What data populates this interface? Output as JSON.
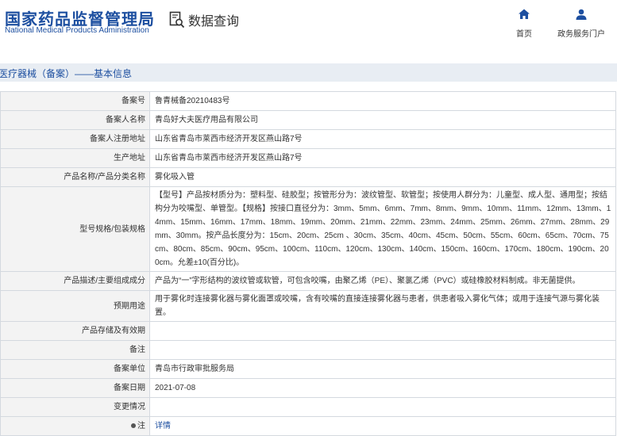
{
  "header": {
    "logo_cn": "国家药品监督管理局",
    "logo_en": "National Medical Products Administration",
    "query_label": "数据查询",
    "nav": [
      {
        "label": "首页",
        "icon": "home-icon"
      },
      {
        "label": "政务服务门户",
        "icon": "user-icon"
      }
    ]
  },
  "section": {
    "title": "医疗器械（备案）——基本信息"
  },
  "rows": [
    {
      "label": "备案号",
      "value": "鲁青械备20210483号"
    },
    {
      "label": "备案人名称",
      "value": "青岛好大夫医疗用品有限公司"
    },
    {
      "label": "备案人注册地址",
      "value": "山东省青岛市莱西市经济开发区燕山路7号"
    },
    {
      "label": "生产地址",
      "value": "山东省青岛市莱西市经济开发区燕山路7号"
    },
    {
      "label": "产品名称/产品分类名称",
      "value": "雾化吸入管"
    },
    {
      "label": "型号规格/包装规格",
      "value": "【型号】产品按材质分为：塑料型、硅胶型；按管形分为：波纹管型、软管型；按使用人群分为：儿童型、成人型、通用型；按结构分为咬嘴型、单管型。【规格】按接口直径分为：3mm、5mm、6mm、7mm、8mm、9mm、10mm、11mm、12mm、13mm、14mm、15mm、16mm、17mm、18mm、19mm、20mm、21mm、22mm、23mm、24mm、25mm、26mm、27mm、28mm、29mm、30mm。按产品长度分为：15cm、20cm、25cm 、30cm、35cm、40cm、45cm、50cm、55cm、60cm、65cm、70cm、75cm、80cm、85cm、90cm、95cm、100cm、110cm、120cm、130cm、140cm、150cm、160cm、170cm、180cm、190cm、200cm。允差±10(百分比)。"
    },
    {
      "label": "产品描述/主要组成成分",
      "value": "产品为“一”字形结构的波纹管或软管，可包含咬嘴，由聚乙烯（PE）、聚氯乙烯（PVC）或硅橡胶材料制成。非无菌提供。"
    },
    {
      "label": "预期用途",
      "value": "用于雾化时连接雾化器与雾化面罩或咬嘴，含有咬嘴的直接连接雾化器与患者，供患者吸入雾化气体；或用于连接气源与雾化装置。"
    },
    {
      "label": "产品存储及有效期",
      "value": ""
    },
    {
      "label": "备注",
      "value": ""
    },
    {
      "label": "备案单位",
      "value": "青岛市行政审批服务局"
    },
    {
      "label": "备案日期",
      "value": "2021-07-08"
    },
    {
      "label": "变更情况",
      "value": ""
    },
    {
      "label": "注",
      "value": "详情"
    }
  ]
}
